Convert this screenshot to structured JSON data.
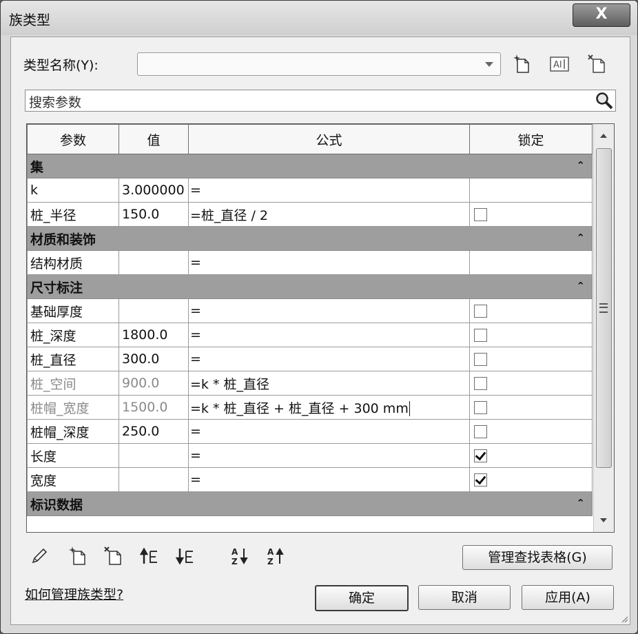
{
  "window": {
    "title": "族类型",
    "close_label": "X"
  },
  "type_name": {
    "label": "类型名称(Y):",
    "value": ""
  },
  "search": {
    "placeholder": "搜索参数"
  },
  "table": {
    "headers": [
      "参数",
      "值",
      "公式",
      "锁定"
    ],
    "groups": [
      {
        "name": "集",
        "rows": [
          {
            "param": "k",
            "value": "3.000000",
            "formula": "=",
            "lock": null,
            "gray": false
          },
          {
            "param": "桩_半径",
            "value": "150.0",
            "formula": "=桩_直径 / 2",
            "lock": false,
            "gray": false
          }
        ]
      },
      {
        "name": "材质和装饰",
        "rows": [
          {
            "param": "结构材质",
            "value": "",
            "formula": "=",
            "lock": null,
            "gray": false
          }
        ]
      },
      {
        "name": "尺寸标注",
        "rows": [
          {
            "param": "基础厚度",
            "value": "",
            "formula": "=",
            "lock": false,
            "gray": false
          },
          {
            "param": "桩_深度",
            "value": "1800.0",
            "formula": "=",
            "lock": false,
            "gray": false
          },
          {
            "param": "桩_直径",
            "value": "300.0",
            "formula": "=",
            "lock": false,
            "gray": false
          },
          {
            "param": "桩_空间",
            "value": "900.0",
            "formula": "=k * 桩_直径",
            "lock": false,
            "gray": true
          },
          {
            "param": "桩帽_宽度",
            "value": "1500.0",
            "formula": "=k * 桩_直径 + 桩_直径 + 300 mm",
            "lock": false,
            "gray": true,
            "editing": true
          },
          {
            "param": "桩帽_深度",
            "value": "250.0",
            "formula": "=",
            "lock": false,
            "gray": false
          },
          {
            "param": "长度",
            "value": "",
            "formula": "=",
            "lock": true,
            "gray": false
          },
          {
            "param": "宽度",
            "value": "",
            "formula": "=",
            "lock": true,
            "gray": false
          }
        ]
      },
      {
        "name": "标识数据",
        "rows": []
      }
    ]
  },
  "buttons": {
    "lookup": "管理查找表格(G)",
    "ok": "确定",
    "cancel": "取消",
    "apply": "应用(A)"
  },
  "help_link": "如何管理族类型?",
  "toolbar_icons": [
    "pencil-icon",
    "new-param-icon",
    "delete-param-icon",
    "move-up-icon",
    "move-down-icon",
    "sort-asc-icon",
    "sort-desc-icon"
  ]
}
